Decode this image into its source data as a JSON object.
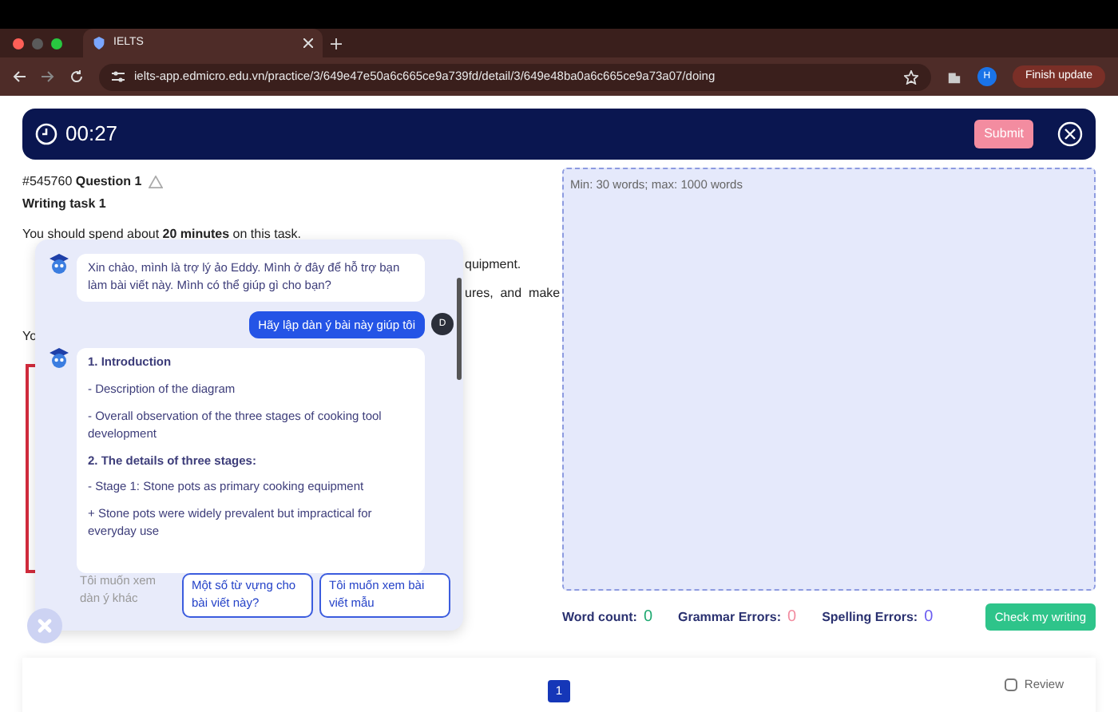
{
  "browser": {
    "tab_title": "IELTS",
    "url": "ielts-app.edmicro.edu.vn/practice/3/649e47e50a6c665ce9a739fd/detail/3/649e48ba0a6c665ce9a73a07/doing",
    "profile": "H",
    "update_button": "Finish update"
  },
  "header": {
    "timer": "00:27",
    "submit": "Submit"
  },
  "question": {
    "id": "#545760",
    "title": "Question 1",
    "task": "Writing task 1",
    "instruction": "You should spend about **20 minutes** on this task.",
    "fragments": [
      "quipment.",
      "ures,  and  make",
      "Yo"
    ]
  },
  "editor": {
    "placeholder": "Min: 30 words; max: 1000 words"
  },
  "stats": [
    {
      "label": "Word count:",
      "value": "0",
      "color": "#1fa971"
    },
    {
      "label": "Grammar Errors:",
      "value": "0",
      "color": "#f28ca0"
    },
    {
      "label": "Spelling Errors:",
      "value": "0",
      "color": "#6a5cf0"
    }
  ],
  "check_button": "Check my writing",
  "chat": {
    "messages": [
      {
        "kind": "bot",
        "lines": [
          {
            "text": "Xin chào, mình là trợ lý ảo Eddy. Mình ở đây để hỗ trợ bạn làm bài viết này. Mình có thể giúp gì cho bạn?",
            "heading": false
          }
        ]
      },
      {
        "kind": "user",
        "text": "Hãy lập dàn ý bài này giúp tôi",
        "avatar": "D"
      },
      {
        "kind": "bot",
        "lines": [
          {
            "text": "1. Introduction",
            "heading": true
          },
          {
            "text": "- Description of the diagram",
            "heading": false
          },
          {
            "text": "- Overall observation of the three stages of cooking tool development",
            "heading": false
          },
          {
            "text": "2. The details of three stages:",
            "heading": true
          },
          {
            "text": "- Stage 1: Stone pots as primary cooking equipment",
            "heading": false
          },
          {
            "text": "+ Stone pots were widely prevalent but impractical for everyday use",
            "heading": false
          }
        ]
      }
    ],
    "suggestions": [
      {
        "kind": "plain",
        "text": "Tôi muốn xem dàn ý khác"
      },
      {
        "kind": "button",
        "text": "Một số từ vựng cho bài viết này?"
      },
      {
        "kind": "button",
        "text": "Tôi muốn xem bài viết mẫu"
      }
    ]
  },
  "pagination": [
    {
      "label": "1",
      "selected": true
    }
  ],
  "review": {
    "label": "Review",
    "checked": false
  }
}
